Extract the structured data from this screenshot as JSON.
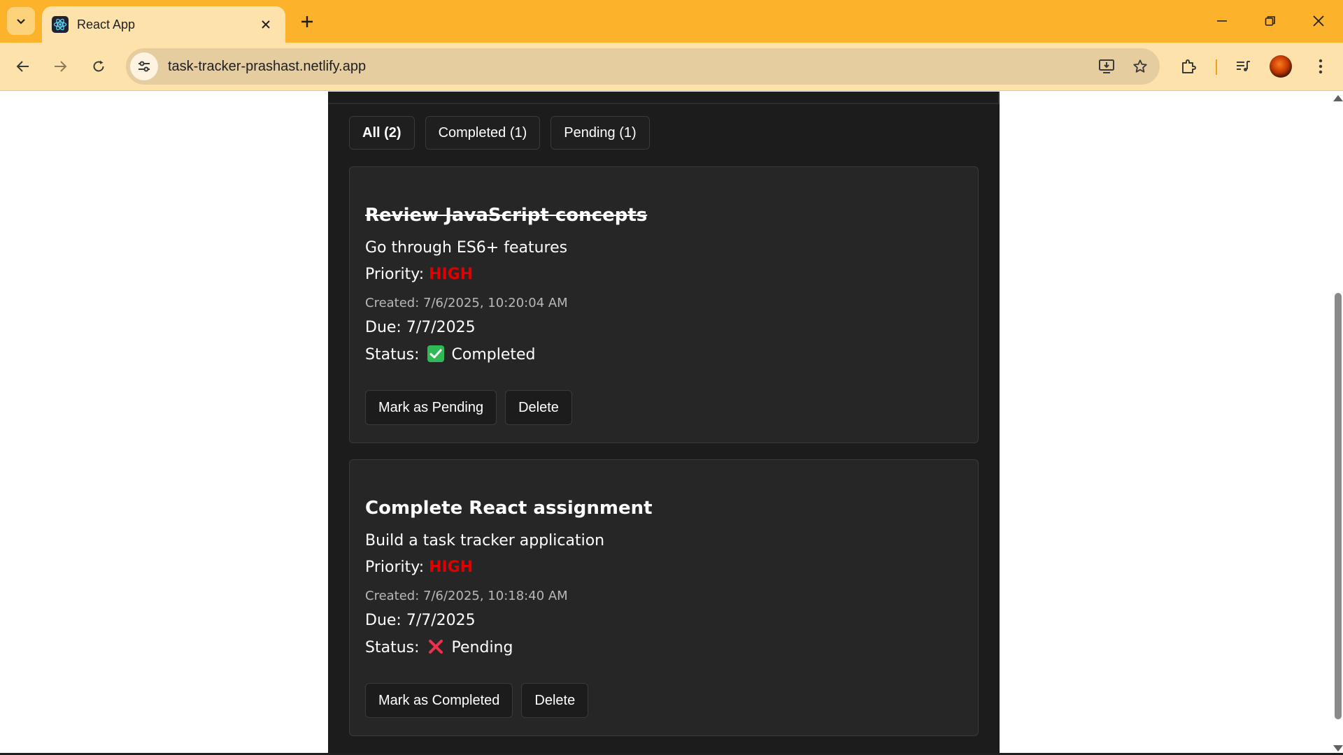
{
  "browser": {
    "tab_title": "React App",
    "url": "task-tracker-prashast.netlify.app",
    "accent_color": "#fdb22b"
  },
  "filters": [
    {
      "label": "All (2)",
      "active": true
    },
    {
      "label": "Completed (1)",
      "active": false
    },
    {
      "label": "Pending (1)",
      "active": false
    }
  ],
  "tasks": [
    {
      "title": "Review JavaScript concepts",
      "description": "Go through ES6+ features",
      "priority_label": "Priority:",
      "priority": "HIGH",
      "created": "Created: 7/6/2025, 10:20:04 AM",
      "due": "Due: 7/7/2025",
      "status_label": "Status:",
      "status": "Completed",
      "status_icon": "check-mark-icon",
      "toggle_label": "Mark as Pending",
      "delete_label": "Delete"
    },
    {
      "title": "Complete React assignment",
      "description": "Build a task tracker application",
      "priority_label": "Priority:",
      "priority": "HIGH",
      "created": "Created: 7/6/2025, 10:18:40 AM",
      "due": "Due: 7/7/2025",
      "status_label": "Status:",
      "status": "Pending",
      "status_icon": "cross-mark-icon",
      "toggle_label": "Mark as Completed",
      "delete_label": "Delete"
    }
  ],
  "colors": {
    "priority_high": "#e00000",
    "app_background": "#1c1c1c",
    "card_background": "#262626"
  }
}
